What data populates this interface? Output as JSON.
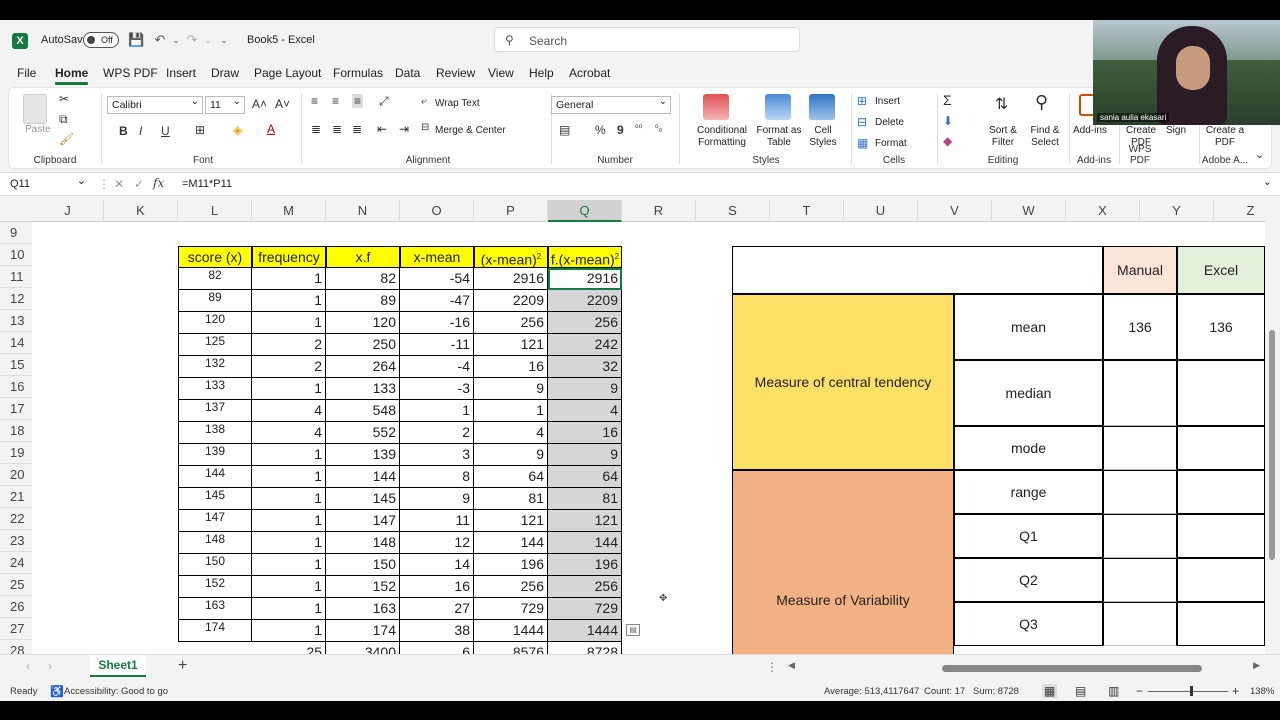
{
  "titlebar": {
    "autosave_label": "AutoSave",
    "autosave_state": "Off",
    "document_title": "Book5  -  Excel",
    "search_placeholder": "Search"
  },
  "menu": [
    "File",
    "Home",
    "WPS PDF",
    "Insert",
    "Draw",
    "Page Layout",
    "Formulas",
    "Data",
    "Review",
    "View",
    "Help",
    "Acrobat"
  ],
  "ribbon": {
    "clipboard": {
      "paste": "Paste",
      "label": "Clipboard"
    },
    "font": {
      "name": "Calibri",
      "size": "11",
      "label": "Font",
      "bold": "B",
      "italic": "I",
      "underline": "U"
    },
    "alignment": {
      "wrap": "Wrap Text",
      "merge": "Merge & Center",
      "label": "Alignment"
    },
    "number": {
      "format": "General",
      "label": "Number",
      "percent": "%",
      "comma": "9"
    },
    "styles": {
      "conditional": "Conditional Formatting",
      "format_table": "Format as Table",
      "cell_styles": "Cell Styles",
      "label": "Styles"
    },
    "cells": {
      "insert": "Insert",
      "delete": "Delete",
      "format": "Format",
      "label": "Cells"
    },
    "editing": {
      "sort": "Sort & Filter",
      "find": "Find & Select",
      "label": "Editing"
    },
    "addins": {
      "addins": "Add-ins",
      "label": "Add-ins"
    },
    "wps": {
      "create": "Create PDF",
      "label": "WPS PDF"
    },
    "adobe": {
      "sign": "Sign",
      "create": "Create a PDF",
      "label": "Adobe A..."
    }
  },
  "formula_bar": {
    "name_box": "Q11",
    "formula": "=M11*P11"
  },
  "columns": [
    "J",
    "K",
    "L",
    "M",
    "N",
    "O",
    "P",
    "Q",
    "R",
    "S",
    "T",
    "U",
    "V",
    "W",
    "X",
    "Y",
    "Z"
  ],
  "rows": [
    "9",
    "10",
    "11",
    "12",
    "13",
    "14",
    "15",
    "16",
    "17",
    "18",
    "19",
    "20",
    "21",
    "22",
    "23",
    "24",
    "25",
    "26",
    "27",
    "28"
  ],
  "table": {
    "headers": [
      "score (x)",
      "frequency",
      "x.f",
      "x-mean",
      "(x-mean)",
      "f.(x-mean)"
    ],
    "sup": "2",
    "rows": [
      [
        "82",
        "1",
        "82",
        "-54",
        "2916",
        "2916"
      ],
      [
        "89",
        "1",
        "89",
        "-47",
        "2209",
        "2209"
      ],
      [
        "120",
        "1",
        "120",
        "-16",
        "256",
        "256"
      ],
      [
        "125",
        "2",
        "250",
        "-11",
        "121",
        "242"
      ],
      [
        "132",
        "2",
        "264",
        "-4",
        "16",
        "32"
      ],
      [
        "133",
        "1",
        "133",
        "-3",
        "9",
        "9"
      ],
      [
        "137",
        "4",
        "548",
        "1",
        "1",
        "4"
      ],
      [
        "138",
        "4",
        "552",
        "2",
        "4",
        "16"
      ],
      [
        "139",
        "1",
        "139",
        "3",
        "9",
        "9"
      ],
      [
        "144",
        "1",
        "144",
        "8",
        "64",
        "64"
      ],
      [
        "145",
        "1",
        "145",
        "9",
        "81",
        "81"
      ],
      [
        "147",
        "1",
        "147",
        "11",
        "121",
        "121"
      ],
      [
        "148",
        "1",
        "148",
        "12",
        "144",
        "144"
      ],
      [
        "150",
        "1",
        "150",
        "14",
        "196",
        "196"
      ],
      [
        "152",
        "1",
        "152",
        "16",
        "256",
        "256"
      ],
      [
        "163",
        "1",
        "163",
        "27",
        "729",
        "729"
      ],
      [
        "174",
        "1",
        "174",
        "38",
        "1444",
        "1444"
      ]
    ],
    "totals": [
      "",
      "25",
      "3400",
      "6",
      "8576",
      "8728"
    ]
  },
  "summary": {
    "manual_label": "Manual",
    "excel_label": "Excel",
    "central_label": "Measure of central tendency",
    "variability_label": "Measure of Variability",
    "measures": [
      "mean",
      "median",
      "mode",
      "range",
      "Q1",
      "Q2",
      "Q3"
    ],
    "mean_manual": "136",
    "mean_excel": "136"
  },
  "sheets": {
    "active": "Sheet1",
    "add": "+"
  },
  "status": {
    "ready": "Ready",
    "accessibility": "Accessibility: Good to go",
    "average": "Average: 513,4117647",
    "count": "Count: 17",
    "sum": "Sum: 8728",
    "zoom": "138%"
  },
  "video": {
    "participant": "sania aulia ekasari"
  }
}
